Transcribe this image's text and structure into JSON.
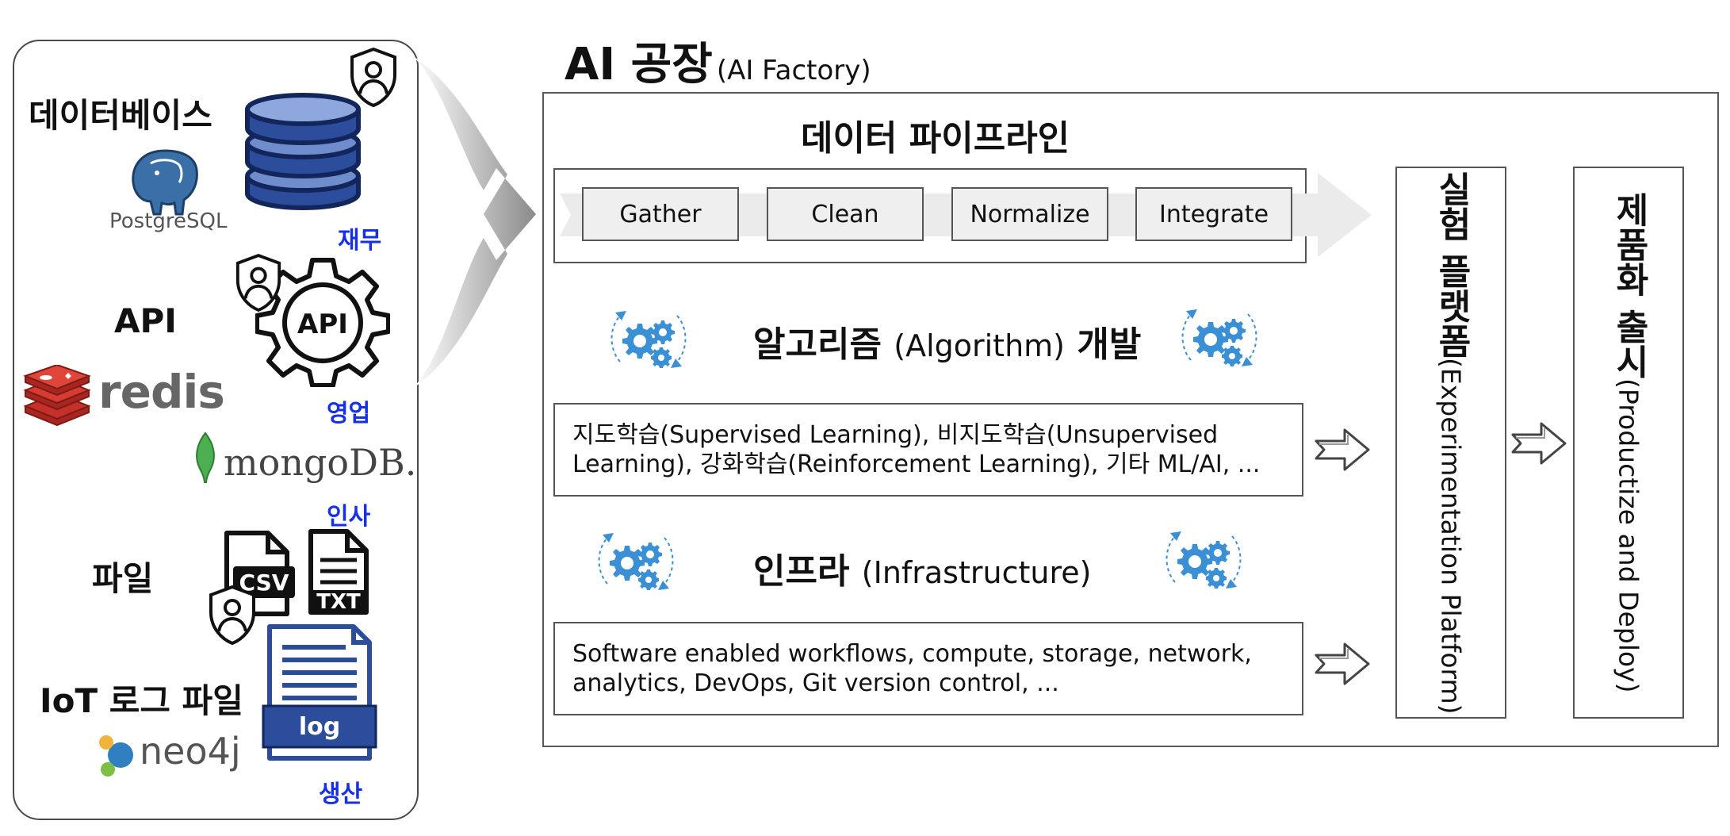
{
  "sources": {
    "database_label": "데이터베이스",
    "api_label": "API",
    "file_label": "파일",
    "iot_label": "IoT 로그 파일",
    "postgres_wordmark": "PostgreSQL",
    "redis_wordmark": "redis",
    "mongodb_wordmark": "mongoDB.",
    "neo4j_wordmark": "neo4j",
    "api_gear_text": "API",
    "csv_text": "CSV",
    "txt_text": "TXT",
    "log_text": "log",
    "departments": {
      "finance": "재무",
      "sales": "영업",
      "hr": "인사",
      "production": "생산"
    }
  },
  "factory": {
    "title": "AI 공장",
    "subtitle": "(AI Factory)",
    "pipeline": {
      "title": "데이터 파이프라인",
      "stages": [
        "Gather",
        "Clean",
        "Normalize",
        "Integrate"
      ]
    },
    "algorithm": {
      "title": "알고리즘",
      "title_en": "(Algorithm)",
      "title_suffix": "개발",
      "line1": "지도학습(Supervised Learning), 비지도학습(Unsupervised",
      "line2": "Learning), 강화학습(Reinforcement Learning), 기타 ML/AI, ..."
    },
    "infrastructure": {
      "title": "인프라",
      "title_en": "(Infrastructure)",
      "line1": "Software enabled workflows, compute, storage, network,",
      "line2": "analytics, DevOps, Git version control, ..."
    },
    "experimentation": {
      "title": "실험 플랫폼",
      "subtitle": "(Experimentation Platform)"
    },
    "productize": {
      "title": "제품화 출시",
      "subtitle": "(Productize and Deploy)"
    }
  },
  "colors": {
    "department_text": "#1630e8",
    "database_blue": "#1f3d8c",
    "gear_blue": "#3b8fd4",
    "redis_red": "#c6302b",
    "mongo_green": "#4caf50",
    "stage_fill": "#efefef"
  },
  "icons": [
    "database-icon",
    "postgresql-elephant-icon",
    "shield-user-icon",
    "api-gear-icon",
    "redis-logo-icon",
    "mongodb-leaf-icon",
    "csv-file-icon",
    "txt-file-icon",
    "log-file-icon",
    "neo4j-logo-icon",
    "gears-cycle-icon",
    "outline-arrow-icon"
  ]
}
